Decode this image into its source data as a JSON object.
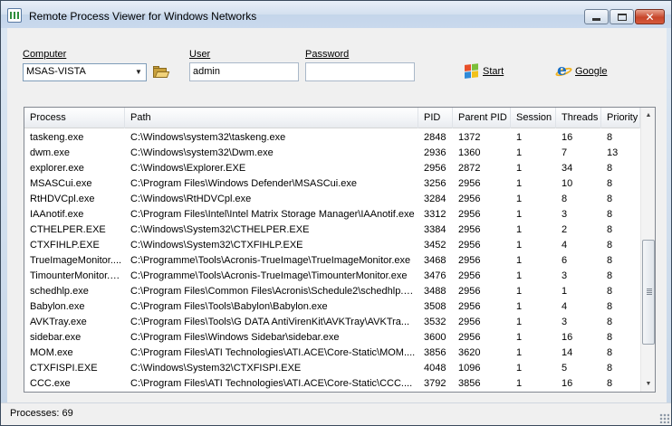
{
  "window": {
    "title": "Remote Process Viewer for Windows Networks",
    "icon": "process-viewer-icon"
  },
  "form": {
    "computer_label": "Computer",
    "computer_value": "MSAS-VISTA",
    "user_label": "User",
    "user_value": "admin",
    "password_label": "Password",
    "password_value": "",
    "start_label": "Start",
    "google_label": "Google"
  },
  "table": {
    "columns": [
      "Process",
      "Path",
      "PID",
      "Parent PID",
      "Session",
      "Threads",
      "Priority"
    ],
    "rows": [
      [
        "taskeng.exe",
        "C:\\Windows\\system32\\taskeng.exe",
        "2848",
        "1372",
        "1",
        "16",
        "8"
      ],
      [
        "dwm.exe",
        "C:\\Windows\\system32\\Dwm.exe",
        "2936",
        "1360",
        "1",
        "7",
        "13"
      ],
      [
        "explorer.exe",
        "C:\\Windows\\Explorer.EXE",
        "2956",
        "2872",
        "1",
        "34",
        "8"
      ],
      [
        "MSASCui.exe",
        "C:\\Program Files\\Windows Defender\\MSASCui.exe",
        "3256",
        "2956",
        "1",
        "10",
        "8"
      ],
      [
        "RtHDVCpl.exe",
        "C:\\Windows\\RtHDVCpl.exe",
        "3284",
        "2956",
        "1",
        "8",
        "8"
      ],
      [
        "IAAnotif.exe",
        "C:\\Program Files\\Intel\\Intel Matrix Storage Manager\\IAAnotif.exe",
        "3312",
        "2956",
        "1",
        "3",
        "8"
      ],
      [
        "CTHELPER.EXE",
        "C:\\Windows\\System32\\CTHELPER.EXE",
        "3384",
        "2956",
        "1",
        "2",
        "8"
      ],
      [
        "CTXFIHLP.EXE",
        "C:\\Windows\\System32\\CTXFIHLP.EXE",
        "3452",
        "2956",
        "1",
        "4",
        "8"
      ],
      [
        "TrueImageMonitor....",
        "C:\\Programme\\Tools\\Acronis-TrueImage\\TrueImageMonitor.exe",
        "3468",
        "2956",
        "1",
        "6",
        "8"
      ],
      [
        "TimounterMonitor.exe",
        "C:\\Programme\\Tools\\Acronis-TrueImage\\TimounterMonitor.exe",
        "3476",
        "2956",
        "1",
        "3",
        "8"
      ],
      [
        "schedhlp.exe",
        "C:\\Program Files\\Common Files\\Acronis\\Schedule2\\schedhlp.exe",
        "3488",
        "2956",
        "1",
        "1",
        "8"
      ],
      [
        "Babylon.exe",
        "C:\\Program Files\\Tools\\Babylon\\Babylon.exe",
        "3508",
        "2956",
        "1",
        "4",
        "8"
      ],
      [
        "AVKTray.exe",
        "C:\\Program Files\\Tools\\G DATA AntiVirenKit\\AVKTray\\AVKTra...",
        "3532",
        "2956",
        "1",
        "3",
        "8"
      ],
      [
        "sidebar.exe",
        "C:\\Program Files\\Windows Sidebar\\sidebar.exe",
        "3600",
        "2956",
        "1",
        "16",
        "8"
      ],
      [
        "MOM.exe",
        "C:\\Program Files\\ATI Technologies\\ATI.ACE\\Core-Static\\MOM....",
        "3856",
        "3620",
        "1",
        "14",
        "8"
      ],
      [
        "CTXFISPI.EXE",
        "C:\\Windows\\System32\\CTXFISPI.EXE",
        "4048",
        "1096",
        "1",
        "5",
        "8"
      ],
      [
        "CCC.exe",
        "C:\\Program Files\\ATI Technologies\\ATI.ACE\\Core-Static\\CCC....",
        "3792",
        "3856",
        "1",
        "16",
        "8"
      ]
    ]
  },
  "status": {
    "text": "Processes: 69"
  }
}
